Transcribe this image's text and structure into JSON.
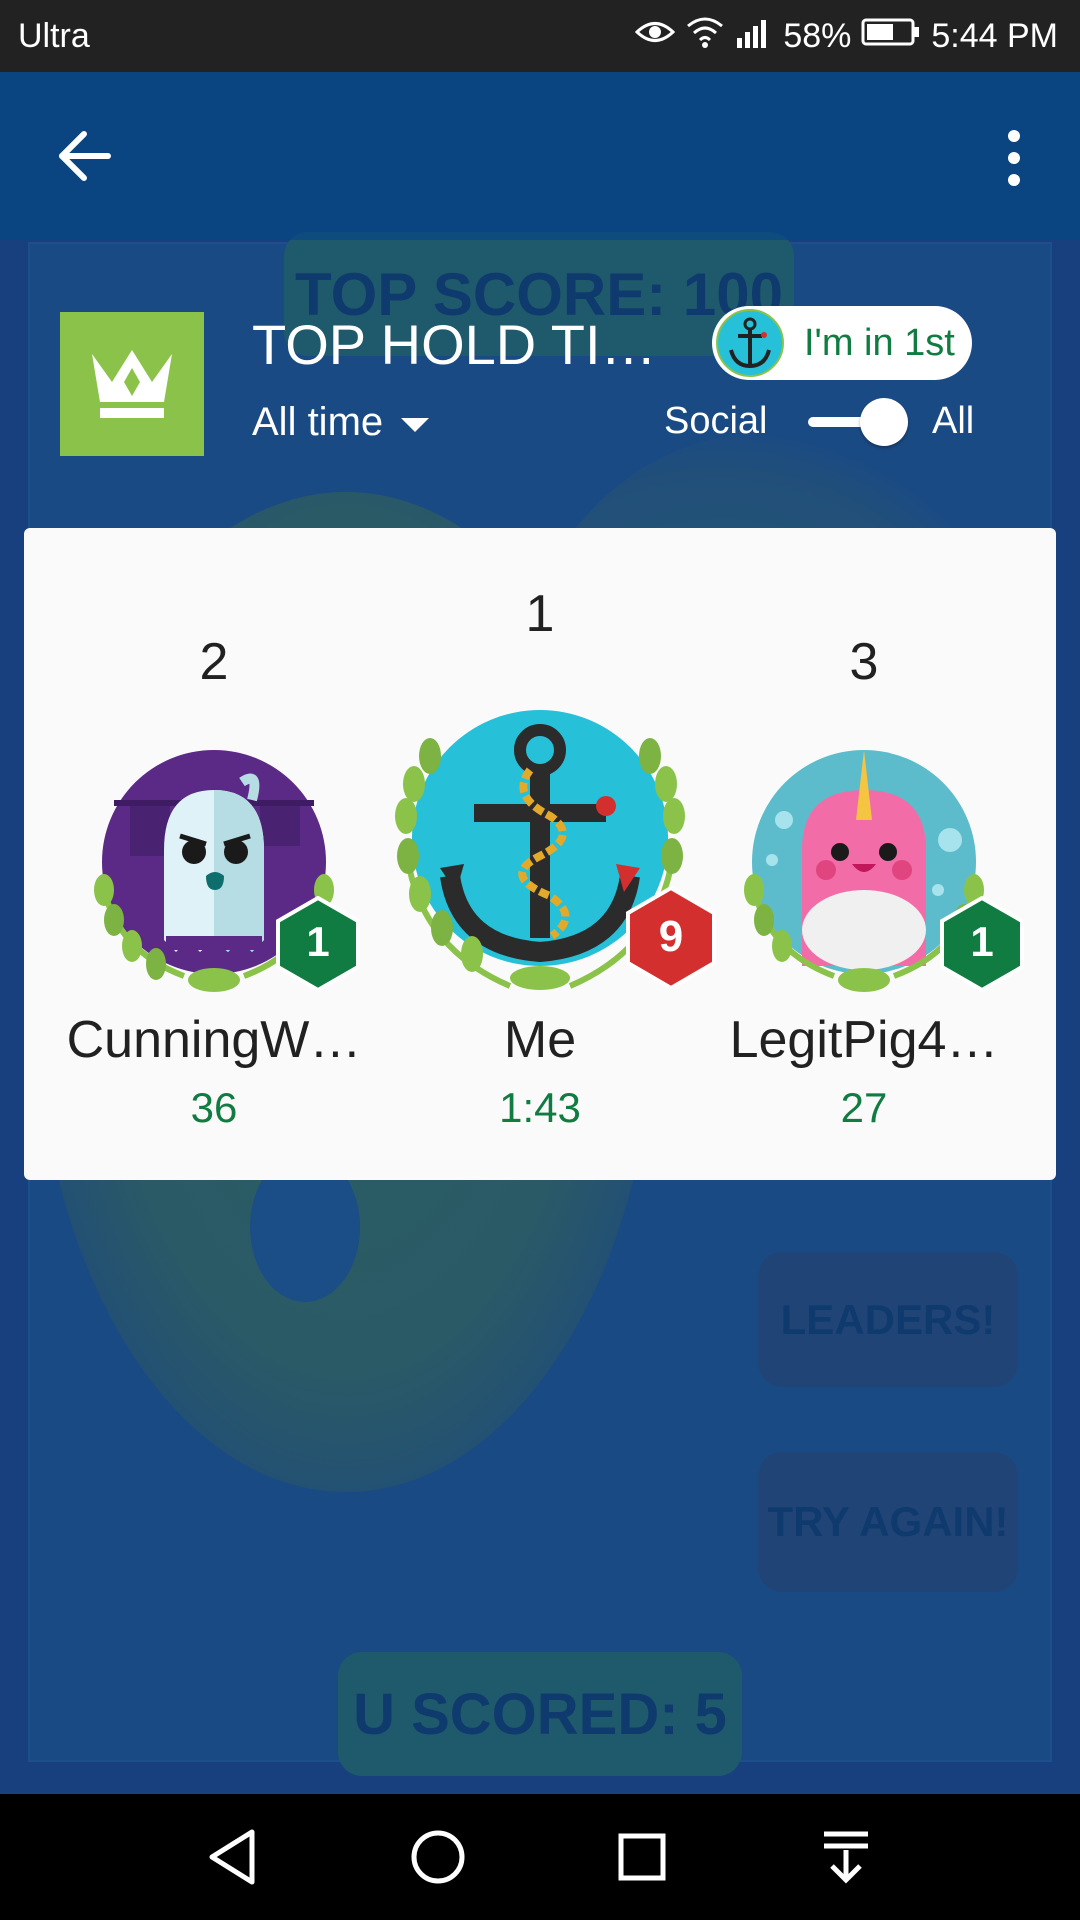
{
  "status_bar": {
    "carrier": "Ultra",
    "battery": "58%",
    "time": "5:44 PM",
    "icons": [
      "eye-icon",
      "wifi-icon",
      "signal-icon",
      "battery-icon"
    ]
  },
  "background": {
    "top_score": "TOP SCORE: 100",
    "leaders": "LEADERS!",
    "try_again": "TRY AGAIN!",
    "u_scored": "U SCORED: 5"
  },
  "app_bar": {
    "back_icon": "arrow-left-icon",
    "more_icon": "more-vert-icon"
  },
  "leaderboard": {
    "title": "TOP HOLD TI…",
    "time_filter": "All time",
    "rank_chip": "I'm in 1st",
    "social_label": "Social",
    "all_label": "All",
    "toggle_state": "All",
    "icon": "crown-icon",
    "accent_color": "#8bc34a",
    "score_color": "#107c41"
  },
  "podium": [
    {
      "rank": "2",
      "name": "CunningW…",
      "score": "36",
      "level": "1",
      "badge_color": "#107c41",
      "avatar": "ghost-avatar"
    },
    {
      "rank": "1",
      "name": "Me",
      "score": "1:43",
      "level": "9",
      "badge_color": "#d32f2f",
      "avatar": "anchor-avatar"
    },
    {
      "rank": "3",
      "name": "LegitPig4…",
      "score": "27",
      "level": "1",
      "badge_color": "#107c41",
      "avatar": "narwhal-avatar"
    }
  ],
  "nav_bar": {
    "icons": [
      "back-triangle-icon",
      "home-circle-icon",
      "recents-square-icon",
      "notification-pull-icon"
    ]
  }
}
